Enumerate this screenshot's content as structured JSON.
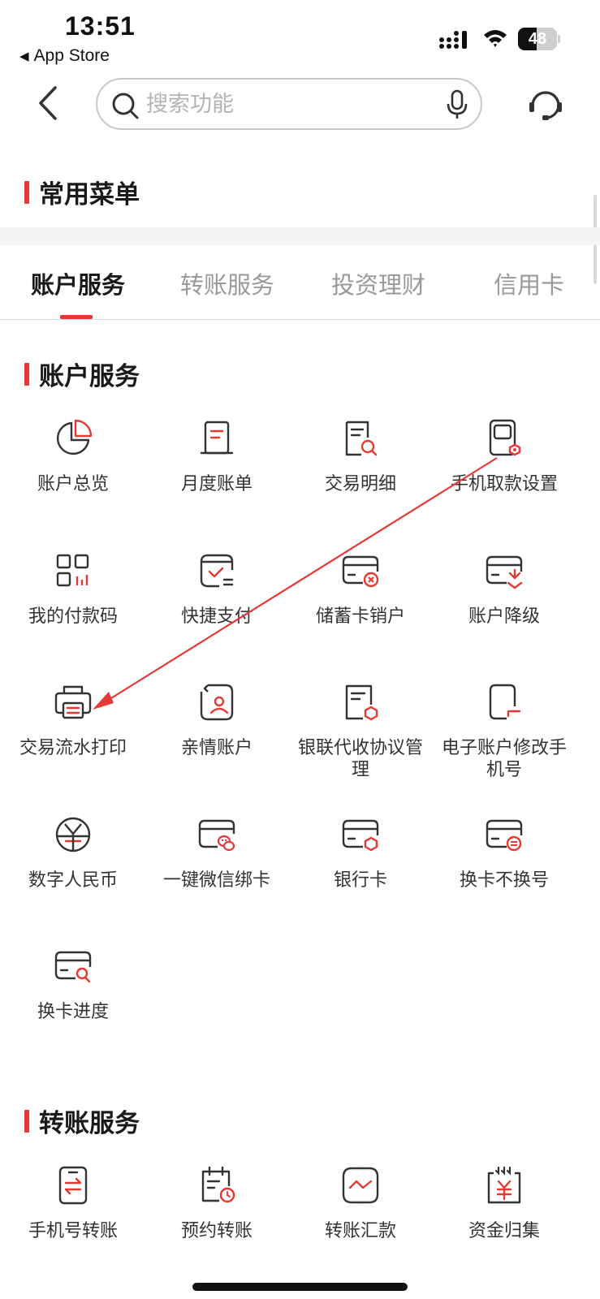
{
  "status_bar": {
    "time": "13:51",
    "back_app": "App Store",
    "battery": "48"
  },
  "search": {
    "placeholder": "搜索功能"
  },
  "sections": {
    "common_menu": "常用菜单",
    "account_services": "账户服务",
    "transfer_services": "转账服务"
  },
  "tabs": [
    "账户服务",
    "转账服务",
    "投资理财",
    "信用卡"
  ],
  "account_items": [
    {
      "label": "账户总览",
      "icon": "pie-chart-icon"
    },
    {
      "label": "月度账单",
      "icon": "bill-icon"
    },
    {
      "label": "交易明细",
      "icon": "document-search-icon"
    },
    {
      "label": "手机取款设置",
      "icon": "phone-settings-icon"
    },
    {
      "label": "我的付款码",
      "icon": "qr-code-icon"
    },
    {
      "label": "快捷支付",
      "icon": "quick-pay-icon"
    },
    {
      "label": "储蓄卡销户",
      "icon": "card-cancel-icon"
    },
    {
      "label": "账户降级",
      "icon": "card-downgrade-icon"
    },
    {
      "label": "交易流水打印",
      "icon": "printer-icon"
    },
    {
      "label": "亲情账户",
      "icon": "family-account-icon"
    },
    {
      "label": "银联代收协议管理",
      "icon": "document-shield-icon"
    },
    {
      "label": "电子账户修改手机号",
      "icon": "phone-edit-icon"
    },
    {
      "label": "数字人民币",
      "icon": "digital-rmb-icon"
    },
    {
      "label": "一键微信绑卡",
      "icon": "wechat-card-icon"
    },
    {
      "label": "银行卡",
      "icon": "bank-card-icon"
    },
    {
      "label": "换卡不换号",
      "icon": "card-swap-icon"
    },
    {
      "label": "换卡进度",
      "icon": "card-progress-icon"
    }
  ],
  "transfer_items": [
    {
      "label": "手机号转账",
      "icon": "phone-transfer-icon"
    },
    {
      "label": "预约转账",
      "icon": "scheduled-transfer-icon"
    },
    {
      "label": "转账汇款",
      "icon": "remittance-icon"
    },
    {
      "label": "资金归集",
      "icon": "fund-collect-icon"
    }
  ],
  "colors": {
    "accent": "#e53935",
    "icon_stroke": "#333333"
  }
}
